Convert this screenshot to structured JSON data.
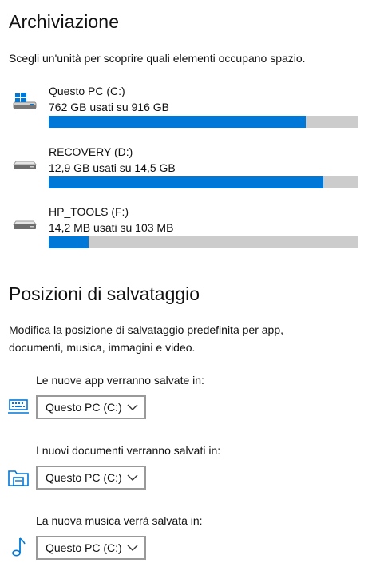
{
  "storage": {
    "title": "Archiviazione",
    "subtitle": "Scegli un'unità per scoprire quali elementi occupano spazio.",
    "drives": [
      {
        "name": "Questo PC (C:)",
        "usage": "762 GB usati su 916 GB",
        "fraction": 0.832,
        "icon": "windows-drive-icon"
      },
      {
        "name": "RECOVERY (D:)",
        "usage": "12,9 GB usati su 14,5 GB",
        "fraction": 0.89,
        "icon": "drive-icon"
      },
      {
        "name": "HP_TOOLS (F:)",
        "usage": "14,2 MB usati su 103 MB",
        "fraction": 0.128,
        "icon": "drive-icon"
      }
    ]
  },
  "save_locations": {
    "title": "Posizioni di salvataggio",
    "description_line1": "Modifica la posizione di salvataggio predefinita per app,",
    "description_line2": "documenti, musica, immagini e video.",
    "items": [
      {
        "label": "Le nuove app verranno salvate in:",
        "value": "Questo PC (C:)",
        "icon": "keyboard-icon"
      },
      {
        "label": "I nuovi documenti verranno salvati in:",
        "value": "Questo PC (C:)",
        "icon": "documents-folder-icon"
      },
      {
        "label": "La nuova musica verrà salvata in:",
        "value": "Questo PC (C:)",
        "icon": "music-note-icon"
      }
    ]
  },
  "colors": {
    "accent": "#0078d7",
    "bar_track": "#cccccc"
  }
}
